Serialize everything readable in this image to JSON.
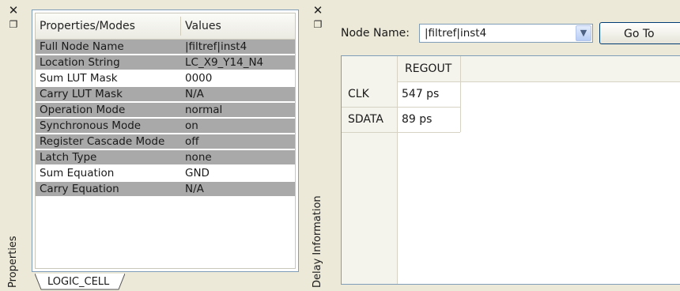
{
  "properties_panel": {
    "dock_label": "Properties",
    "columns": [
      "Properties/Modes",
      "Values"
    ],
    "rows": [
      {
        "name": "Full Node Name",
        "value": "|filtref|inst4",
        "highlight": "gray"
      },
      {
        "name": "Location String",
        "value": "LC_X9_Y14_N4",
        "highlight": "gray"
      },
      {
        "name": "Sum LUT Mask",
        "value": "0000",
        "highlight": "white"
      },
      {
        "name": "Carry LUT Mask",
        "value": "N/A",
        "highlight": "gray"
      },
      {
        "name": "Operation Mode",
        "value": "normal",
        "highlight": "gray"
      },
      {
        "name": "Synchronous Mode",
        "value": "on",
        "highlight": "gray"
      },
      {
        "name": "Register Cascade Mode",
        "value": "off",
        "highlight": "gray"
      },
      {
        "name": "Latch Type",
        "value": "none",
        "highlight": "gray"
      },
      {
        "name": "Sum Equation",
        "value": "GND",
        "highlight": "white"
      },
      {
        "name": "Carry Equation",
        "value": "N/A",
        "highlight": "gray"
      }
    ],
    "tab": "LOGIC_CELL",
    "icons": {
      "close": "close-icon",
      "float": "float-window-icon"
    }
  },
  "delay_panel": {
    "dock_label": "Delay Information",
    "node_name_label": "Node Name:",
    "node_name_value": "|filtref|inst4",
    "goto_label": "Go To",
    "column_header": "REGOUT",
    "rows": [
      {
        "label": "CLK",
        "value": "547 ps"
      },
      {
        "label": "SDATA",
        "value": "89 ps"
      }
    ],
    "icons": {
      "close": "close-icon",
      "float": "float-window-icon",
      "dropdown": "chevron-down-icon"
    }
  },
  "colors": {
    "gray_row": "#a9a9a9",
    "panel_bg": "#ece9d8",
    "border": "#7f9db9"
  }
}
